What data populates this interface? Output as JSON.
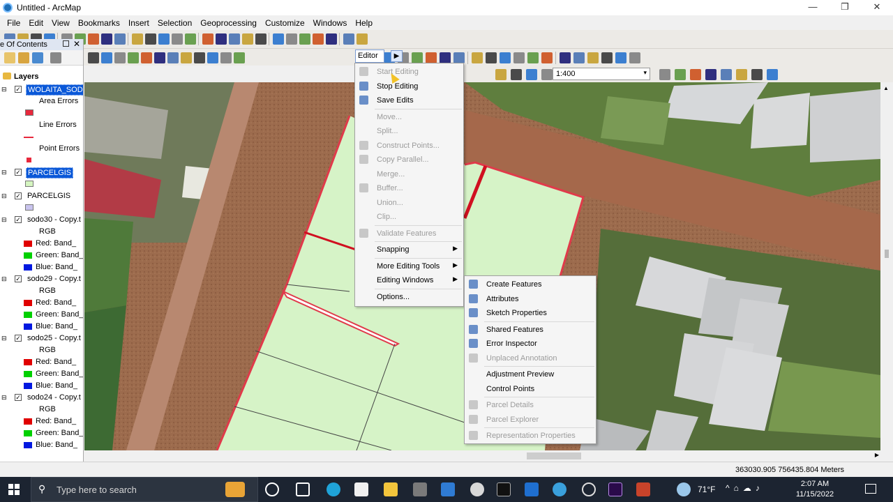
{
  "window": {
    "title": "Untitled - ArcMap",
    "minimize": "—",
    "restore": "❐",
    "close": "✕"
  },
  "menubar": [
    "File",
    "Edit",
    "View",
    "Bookmarks",
    "Insert",
    "Selection",
    "Geoprocessing",
    "Customize",
    "Windows",
    "Help"
  ],
  "editor_toolbar": {
    "label": "Editor ▾",
    "scale": "1:400"
  },
  "toc": {
    "title": "e Of Contents",
    "layers_label": "Layers",
    "rows": [
      {
        "text": "WOLAITA_SOD",
        "kind": "layer",
        "selected": true,
        "checked": true
      },
      {
        "text": "Area Errors",
        "kind": "label"
      },
      {
        "text": "",
        "kind": "swatch",
        "color": "#e8283c"
      },
      {
        "text": "Line Errors",
        "kind": "label"
      },
      {
        "text": "",
        "kind": "swatch-line",
        "color": "#e8283c"
      },
      {
        "text": "Point Errors",
        "kind": "label"
      },
      {
        "text": "",
        "kind": "swatch-point",
        "color": "#e8283c"
      },
      {
        "text": "PARCELGIS",
        "kind": "layer",
        "selected": true,
        "checked": true
      },
      {
        "text": "",
        "kind": "swatch",
        "color": "#d5f5c0"
      },
      {
        "text": "PARCELGIS",
        "kind": "layer",
        "selected": false,
        "checked": true
      },
      {
        "text": "",
        "kind": "swatch",
        "color": "#c9c4ee"
      },
      {
        "text": "sodo30 - Copy.t",
        "kind": "layer",
        "selected": false,
        "checked": true
      },
      {
        "text": "RGB",
        "kind": "sub"
      },
      {
        "text": "Red:   Band_",
        "kind": "band",
        "color": "#e00000"
      },
      {
        "text": "Green: Band_",
        "kind": "band",
        "color": "#00d000"
      },
      {
        "text": "Blue:  Band_",
        "kind": "band",
        "color": "#0018e0"
      },
      {
        "text": "sodo29 - Copy.t",
        "kind": "layer",
        "selected": false,
        "checked": true
      },
      {
        "text": "RGB",
        "kind": "sub"
      },
      {
        "text": "Red:   Band_",
        "kind": "band",
        "color": "#e00000"
      },
      {
        "text": "Green: Band_",
        "kind": "band",
        "color": "#00d000"
      },
      {
        "text": "Blue:  Band_",
        "kind": "band",
        "color": "#0018e0"
      },
      {
        "text": "sodo25 - Copy.t",
        "kind": "layer",
        "selected": false,
        "checked": true
      },
      {
        "text": "RGB",
        "kind": "sub"
      },
      {
        "text": "Red:   Band_",
        "kind": "band",
        "color": "#e00000"
      },
      {
        "text": "Green: Band_",
        "kind": "band",
        "color": "#00d000"
      },
      {
        "text": "Blue:  Band_",
        "kind": "band",
        "color": "#0018e0"
      },
      {
        "text": "sodo24 - Copy.t",
        "kind": "layer",
        "selected": false,
        "checked": true
      },
      {
        "text": "RGB",
        "kind": "sub"
      },
      {
        "text": "Red:   Band_",
        "kind": "band",
        "color": "#e00000"
      },
      {
        "text": "Green: Band_",
        "kind": "band",
        "color": "#00d000"
      },
      {
        "text": "Blue:  Band_",
        "kind": "band",
        "color": "#0018e0"
      }
    ]
  },
  "editor_menu": [
    {
      "label": "Start Editing",
      "disabled": true,
      "icon": "pencil-icon",
      "sep_after": false
    },
    {
      "label": "Stop Editing",
      "disabled": false,
      "icon": "pencil-icon",
      "sep_after": false
    },
    {
      "label": "Save Edits",
      "disabled": false,
      "icon": "save-icon",
      "sep_after": true
    },
    {
      "label": "Move...",
      "disabled": true,
      "icon": "",
      "sep_after": false
    },
    {
      "label": "Split...",
      "disabled": true,
      "icon": "",
      "sep_after": false
    },
    {
      "label": "Construct Points...",
      "disabled": true,
      "icon": "construct-icon",
      "sep_after": false
    },
    {
      "label": "Copy Parallel...",
      "disabled": true,
      "icon": "copy-parallel-icon",
      "sep_after": false
    },
    {
      "label": "Merge...",
      "disabled": true,
      "icon": "",
      "sep_after": false
    },
    {
      "label": "Buffer...",
      "disabled": true,
      "icon": "buffer-icon",
      "sep_after": false
    },
    {
      "label": "Union...",
      "disabled": true,
      "icon": "",
      "sep_after": false
    },
    {
      "label": "Clip...",
      "disabled": true,
      "icon": "",
      "sep_after": true
    },
    {
      "label": "Validate Features",
      "disabled": true,
      "icon": "validate-icon",
      "sep_after": true
    },
    {
      "label": "Snapping",
      "disabled": false,
      "icon": "",
      "sub": true,
      "sep_after": true
    },
    {
      "label": "More Editing Tools",
      "disabled": false,
      "icon": "",
      "sub": true,
      "sep_after": false
    },
    {
      "label": "Editing Windows",
      "disabled": false,
      "icon": "",
      "sub": true,
      "sep_after": true
    },
    {
      "label": "Options...",
      "disabled": false,
      "icon": "",
      "sep_after": false
    }
  ],
  "submenu": [
    {
      "label": "Create Features",
      "disabled": false,
      "icon": "create-features-icon",
      "sep_after": false
    },
    {
      "label": "Attributes",
      "disabled": false,
      "icon": "attributes-icon",
      "sep_after": false
    },
    {
      "label": "Sketch Properties",
      "disabled": false,
      "icon": "sketch-icon",
      "sep_after": true
    },
    {
      "label": "Shared Features",
      "disabled": false,
      "icon": "shared-features-icon",
      "sep_after": false
    },
    {
      "label": "Error Inspector",
      "disabled": false,
      "icon": "error-inspector-icon",
      "sep_after": false
    },
    {
      "label": "Unplaced Annotation",
      "disabled": true,
      "icon": "annotation-icon",
      "sep_after": true
    },
    {
      "label": "Adjustment Preview",
      "disabled": false,
      "icon": "",
      "sep_after": false
    },
    {
      "label": "Control Points",
      "disabled": false,
      "icon": "",
      "sep_after": true
    },
    {
      "label": "Parcel Details",
      "disabled": true,
      "icon": "parcel-icon",
      "sep_after": false
    },
    {
      "label": "Parcel Explorer",
      "disabled": true,
      "icon": "parcel-icon",
      "sep_after": true
    },
    {
      "label": "Representation Properties",
      "disabled": true,
      "icon": "representation-icon",
      "sep_after": false
    }
  ],
  "status": {
    "coords": "363030.905  756435.804 Meters"
  },
  "taskbar": {
    "search_placeholder": "Type here to search",
    "weather": "71°F",
    "time": "2:07 AM",
    "date": "11/15/2022"
  }
}
